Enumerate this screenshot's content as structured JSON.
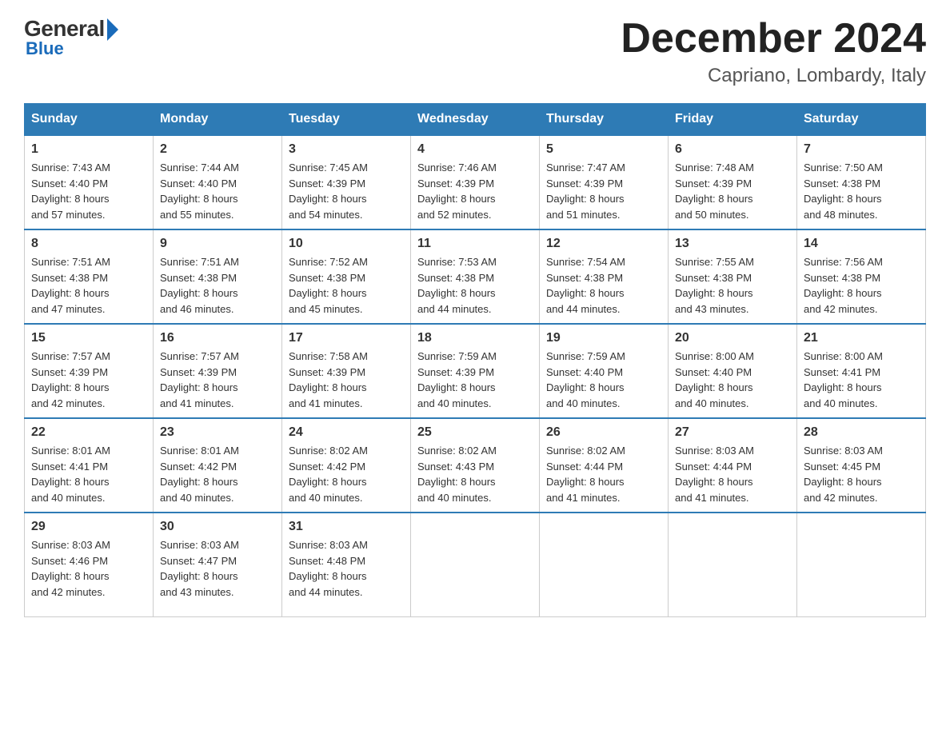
{
  "logo": {
    "general": "General",
    "blue": "Blue"
  },
  "header": {
    "month": "December 2024",
    "location": "Capriano, Lombardy, Italy"
  },
  "days_of_week": [
    "Sunday",
    "Monday",
    "Tuesday",
    "Wednesday",
    "Thursday",
    "Friday",
    "Saturday"
  ],
  "weeks": [
    [
      {
        "day": "1",
        "sunrise": "7:43 AM",
        "sunset": "4:40 PM",
        "daylight": "8 hours and 57 minutes."
      },
      {
        "day": "2",
        "sunrise": "7:44 AM",
        "sunset": "4:40 PM",
        "daylight": "8 hours and 55 minutes."
      },
      {
        "day": "3",
        "sunrise": "7:45 AM",
        "sunset": "4:39 PM",
        "daylight": "8 hours and 54 minutes."
      },
      {
        "day": "4",
        "sunrise": "7:46 AM",
        "sunset": "4:39 PM",
        "daylight": "8 hours and 52 minutes."
      },
      {
        "day": "5",
        "sunrise": "7:47 AM",
        "sunset": "4:39 PM",
        "daylight": "8 hours and 51 minutes."
      },
      {
        "day": "6",
        "sunrise": "7:48 AM",
        "sunset": "4:39 PM",
        "daylight": "8 hours and 50 minutes."
      },
      {
        "day": "7",
        "sunrise": "7:50 AM",
        "sunset": "4:38 PM",
        "daylight": "8 hours and 48 minutes."
      }
    ],
    [
      {
        "day": "8",
        "sunrise": "7:51 AM",
        "sunset": "4:38 PM",
        "daylight": "8 hours and 47 minutes."
      },
      {
        "day": "9",
        "sunrise": "7:51 AM",
        "sunset": "4:38 PM",
        "daylight": "8 hours and 46 minutes."
      },
      {
        "day": "10",
        "sunrise": "7:52 AM",
        "sunset": "4:38 PM",
        "daylight": "8 hours and 45 minutes."
      },
      {
        "day": "11",
        "sunrise": "7:53 AM",
        "sunset": "4:38 PM",
        "daylight": "8 hours and 44 minutes."
      },
      {
        "day": "12",
        "sunrise": "7:54 AM",
        "sunset": "4:38 PM",
        "daylight": "8 hours and 44 minutes."
      },
      {
        "day": "13",
        "sunrise": "7:55 AM",
        "sunset": "4:38 PM",
        "daylight": "8 hours and 43 minutes."
      },
      {
        "day": "14",
        "sunrise": "7:56 AM",
        "sunset": "4:38 PM",
        "daylight": "8 hours and 42 minutes."
      }
    ],
    [
      {
        "day": "15",
        "sunrise": "7:57 AM",
        "sunset": "4:39 PM",
        "daylight": "8 hours and 42 minutes."
      },
      {
        "day": "16",
        "sunrise": "7:57 AM",
        "sunset": "4:39 PM",
        "daylight": "8 hours and 41 minutes."
      },
      {
        "day": "17",
        "sunrise": "7:58 AM",
        "sunset": "4:39 PM",
        "daylight": "8 hours and 41 minutes."
      },
      {
        "day": "18",
        "sunrise": "7:59 AM",
        "sunset": "4:39 PM",
        "daylight": "8 hours and 40 minutes."
      },
      {
        "day": "19",
        "sunrise": "7:59 AM",
        "sunset": "4:40 PM",
        "daylight": "8 hours and 40 minutes."
      },
      {
        "day": "20",
        "sunrise": "8:00 AM",
        "sunset": "4:40 PM",
        "daylight": "8 hours and 40 minutes."
      },
      {
        "day": "21",
        "sunrise": "8:00 AM",
        "sunset": "4:41 PM",
        "daylight": "8 hours and 40 minutes."
      }
    ],
    [
      {
        "day": "22",
        "sunrise": "8:01 AM",
        "sunset": "4:41 PM",
        "daylight": "8 hours and 40 minutes."
      },
      {
        "day": "23",
        "sunrise": "8:01 AM",
        "sunset": "4:42 PM",
        "daylight": "8 hours and 40 minutes."
      },
      {
        "day": "24",
        "sunrise": "8:02 AM",
        "sunset": "4:42 PM",
        "daylight": "8 hours and 40 minutes."
      },
      {
        "day": "25",
        "sunrise": "8:02 AM",
        "sunset": "4:43 PM",
        "daylight": "8 hours and 40 minutes."
      },
      {
        "day": "26",
        "sunrise": "8:02 AM",
        "sunset": "4:44 PM",
        "daylight": "8 hours and 41 minutes."
      },
      {
        "day": "27",
        "sunrise": "8:03 AM",
        "sunset": "4:44 PM",
        "daylight": "8 hours and 41 minutes."
      },
      {
        "day": "28",
        "sunrise": "8:03 AM",
        "sunset": "4:45 PM",
        "daylight": "8 hours and 42 minutes."
      }
    ],
    [
      {
        "day": "29",
        "sunrise": "8:03 AM",
        "sunset": "4:46 PM",
        "daylight": "8 hours and 42 minutes."
      },
      {
        "day": "30",
        "sunrise": "8:03 AM",
        "sunset": "4:47 PM",
        "daylight": "8 hours and 43 minutes."
      },
      {
        "day": "31",
        "sunrise": "8:03 AM",
        "sunset": "4:48 PM",
        "daylight": "8 hours and 44 minutes."
      },
      null,
      null,
      null,
      null
    ]
  ],
  "labels": {
    "sunrise": "Sunrise:",
    "sunset": "Sunset:",
    "daylight": "Daylight:"
  }
}
